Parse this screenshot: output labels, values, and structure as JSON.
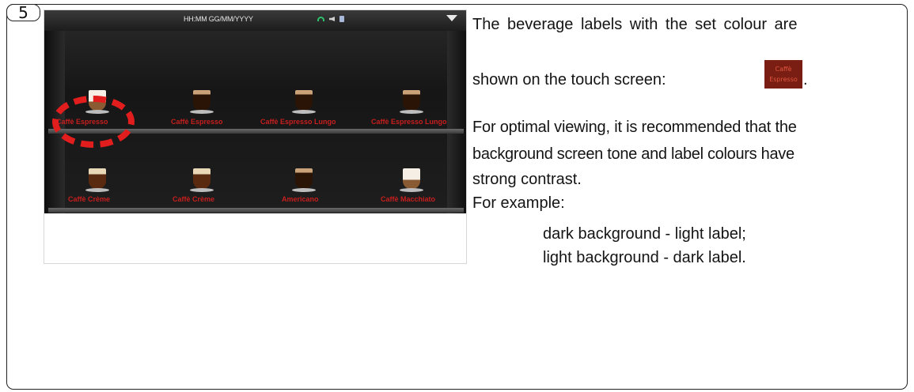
{
  "step_badge": "5",
  "machine_screen": {
    "status_text": "HH:MM GG/MM/YYYY",
    "icons": [
      "wifi-icon",
      "speaker-icon",
      "cup-icon",
      "menu-arrow-icon"
    ],
    "beverages_row1": [
      "Caffè Espresso",
      "Caffè Espresso",
      "Caffè Espresso Lungo",
      "Caffè Espresso Lungo"
    ],
    "beverages_row2": [
      "Caffè Crème",
      "Caffè Crème",
      "Americano",
      "Caffè Macchiato"
    ],
    "label_color": "#c81e1e",
    "highlight_color": "#e11d1d"
  },
  "text": {
    "line1": "The beverage labels with the set colour are",
    "line2": "shown on the touch screen:",
    "line2_end": ".",
    "chip_line1": "Caffè",
    "chip_line2": "Espresso",
    "para2_l1": "For optimal viewing, it is recommended that the",
    "para2_l2": "background screen tone and label colours have",
    "para2_l3": "strong contrast.",
    "example": "For example:",
    "ex1": "dark background - light label;",
    "ex2": "light background - dark label."
  },
  "chip_color": "#7a1e14"
}
